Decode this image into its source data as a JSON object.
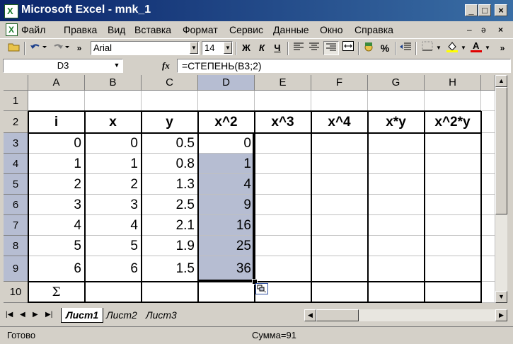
{
  "window": {
    "title": "Microsoft Excel - mnk_1",
    "minimize": "_",
    "maximize": "□",
    "close": "×"
  },
  "menu": {
    "items": [
      "Файл",
      "Правка",
      "Вид",
      "Вставка",
      "Формат",
      "Сервис",
      "Данные",
      "Окно",
      "Справка"
    ],
    "mdi_min": "–",
    "mdi_restore": "ǝ",
    "mdi_close": "×"
  },
  "toolbar": {
    "font_name": "Arial",
    "font_size": "14",
    "bold": "Ж",
    "italic": "К",
    "underline": "Ч",
    "percent": "%",
    "more": "»"
  },
  "formula_bar": {
    "name_box": "D3",
    "fx_label": "fx",
    "formula": "=СТЕПЕНЬ(B3;2)"
  },
  "grid": {
    "columns": [
      "A",
      "B",
      "C",
      "D",
      "E",
      "F",
      "G",
      "H"
    ],
    "rows": [
      "1",
      "2",
      "3",
      "4",
      "5",
      "6",
      "7",
      "8",
      "9",
      "10"
    ],
    "selected_column": "D",
    "selected_rows": [
      "3",
      "4",
      "5",
      "6",
      "7",
      "8",
      "9"
    ],
    "headers": [
      "i",
      "x",
      "y",
      "x^2",
      "x^3",
      "x^4",
      "x*y",
      "x^2*y"
    ],
    "data": [
      [
        "0",
        "0",
        "0.5",
        "0"
      ],
      [
        "1",
        "1",
        "0.8",
        "1"
      ],
      [
        "2",
        "2",
        "1.3",
        "4"
      ],
      [
        "3",
        "3",
        "2.5",
        "9"
      ],
      [
        "4",
        "4",
        "2.1",
        "16"
      ],
      [
        "5",
        "5",
        "1.9",
        "25"
      ],
      [
        "6",
        "6",
        "1.5",
        "36"
      ]
    ],
    "sum_symbol": "Σ"
  },
  "sheets": {
    "tabs": [
      "Лист1",
      "Лист2",
      "Лист3"
    ],
    "active": "Лист1"
  },
  "status": {
    "ready": "Готово",
    "sum": "Сумма=91"
  }
}
